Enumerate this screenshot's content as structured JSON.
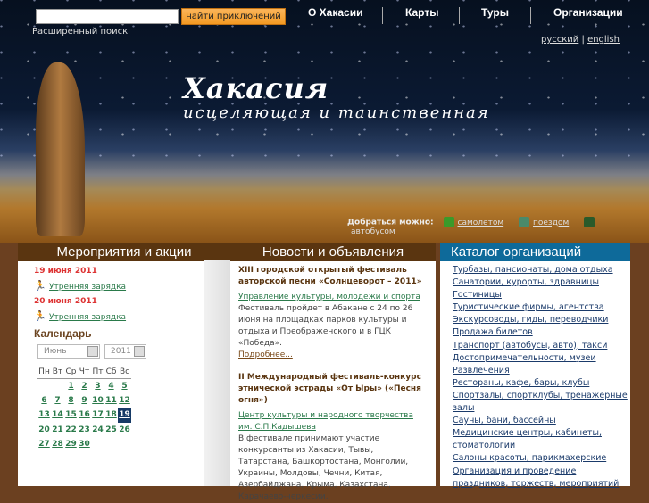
{
  "search": {
    "placeholder": "",
    "button": "найти приключений",
    "advanced": "Расширенный поиск"
  },
  "nav": [
    "О Хакасии",
    "Карты",
    "Туры",
    "Организации"
  ],
  "lang": {
    "ru": "русский",
    "sep": "|",
    "en": "english"
  },
  "banner": {
    "title": "Хакасия",
    "subtitle": "исцеляющая и таинственная"
  },
  "transport": {
    "label": "Добраться можно:",
    "items": [
      "самолетом",
      "поездом",
      "автобусом"
    ]
  },
  "events": {
    "title": "Мероприятия и акции",
    "items": [
      {
        "date": "19 июня 2011",
        "name": "Утренняя зарядка"
      },
      {
        "date": "20 июня 2011",
        "name": "Утренняя зарядка"
      }
    ]
  },
  "calendar": {
    "title": "Календарь",
    "month": "Июнь",
    "year": "2011",
    "weekdays": [
      "Пн",
      "Вт",
      "Ср",
      "Чт",
      "Пт",
      "Сб",
      "Вс"
    ],
    "today": "19",
    "weeks": [
      [
        "",
        "",
        "1",
        "2",
        "3",
        "4",
        "5"
      ],
      [
        "6",
        "7",
        "8",
        "9",
        "10",
        "11",
        "12"
      ],
      [
        "13",
        "14",
        "15",
        "16",
        "17",
        "18",
        "19"
      ],
      [
        "20",
        "21",
        "22",
        "23",
        "24",
        "25",
        "26"
      ],
      [
        "27",
        "28",
        "29",
        "30",
        "",
        "",
        ""
      ]
    ]
  },
  "news": {
    "title": "Новости и объявления",
    "items": [
      {
        "title": "XIII городской открытый фестиваль авторской песни «Солнцеворот – 2011»",
        "source": "Управление культуры, молодежи и спорта",
        "text": "Фестиваль пройдет в Абакане с 24 по 26 июня на площадках парков культуры и отдыха и Преображенского и в ГЦК «Победа».",
        "more": "Подробнее..."
      },
      {
        "title": "II Международный фестиваль-конкурс этнической эстрады «От Ыры» («Песня огня»)",
        "source": "Центр культуры и народного творчества им. С.П.Кадышева",
        "text": "В фестивале принимают участие конкурсанты из Хакасии, Тывы, Татарстана, Башкортостана, Монголии, Украины, Молдовы, Чечни, Китая, Азербайджана, Крыма, Казахстана, Карачаево-черкесии,"
      }
    ]
  },
  "catalog": {
    "title": "Каталог организаций",
    "items": [
      "Турбазы, пансионаты, дома отдыха",
      "Санатории, курорты, здравницы",
      "Гостиницы",
      "Туристические фирмы, агентства",
      "Экскурсоводы, гиды, переводчики",
      "Продажа билетов",
      "Транспорт (автобусы, авто), такси",
      "Достопримечательности, музеи",
      "Развлечения",
      "Рестораны, кафе, бары, клубы",
      "Спортзалы, спортклубы, тренажерные залы",
      "Сауны, бани, бассейны",
      "Медицинские центры, кабинеты, стоматологии",
      "Салоны красоты, парикмахерские",
      "Организация и проведение праздников, торжеств, мероприятий"
    ]
  }
}
